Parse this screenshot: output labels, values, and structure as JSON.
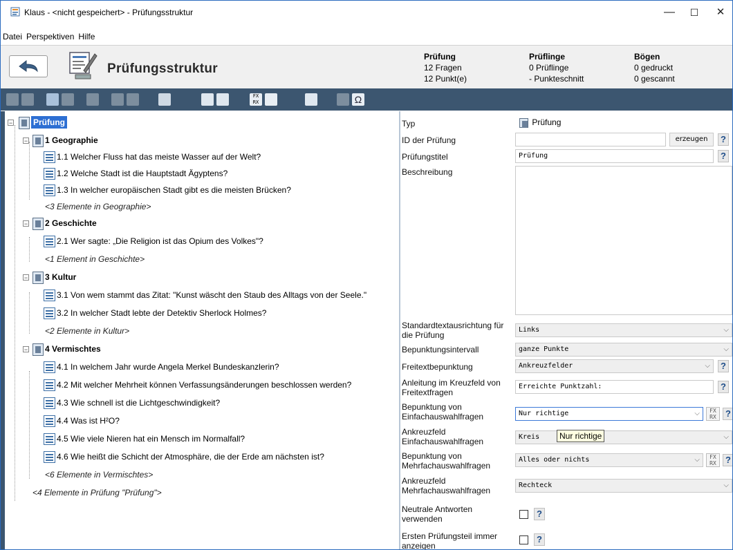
{
  "window": {
    "title": "Klaus - <nicht gespeichert> - Prüfungsstruktur",
    "minimize": "—",
    "maximize": "☐",
    "close": "✕"
  },
  "menu": [
    "Datei",
    "Perspektiven",
    "Hilfe"
  ],
  "header": {
    "title": "Prüfungsstruktur",
    "stats": [
      {
        "heading": "Prüfung",
        "line1": "12 Fragen",
        "line2": "12 Punkt(e)"
      },
      {
        "heading": "Prüflinge",
        "line1": "0 Prüflinge",
        "line2": "- Punkteschnitt"
      },
      {
        "heading": "Bögen",
        "line1": "0 gedruckt",
        "line2": "0 gescannt"
      }
    ]
  },
  "tree": {
    "root": "Prüfung",
    "sections": [
      {
        "label": "1 Geographie",
        "questions": [
          "1.1 Welcher Fluss hat das meiste Wasser auf der Welt?",
          "1.2 Welche Stadt ist die Hauptstadt Ägyptens?",
          "1.3 In welcher europäischen Stadt gibt es die meisten Brücken?"
        ],
        "summary": "<3 Elemente in Geographie>"
      },
      {
        "label": "2 Geschichte",
        "questions": [
          "2.1 Wer sagte: „Die Religion ist das Opium des Volkes\"?"
        ],
        "summary": "<1 Element in Geschichte>"
      },
      {
        "label": "3 Kultur",
        "questions": [
          "3.1 Von wem stammt das Zitat: \"Kunst wäscht den Staub des Alltags von der Seele.\"",
          "3.2 In welcher Stadt lebte der Detektiv Sherlock Holmes?"
        ],
        "summary": "<2 Elemente in Kultur>"
      },
      {
        "label": "4 Vermischtes",
        "questions": [
          "4.1 In welchem Jahr wurde Angela Merkel Bundeskanzlerin?",
          "4.2 Mit welcher Mehrheit können Verfassungsänderungen beschlossen werden?",
          "4.3 Wie schnell ist die Lichtgeschwindigkeit?",
          "4.4 Was ist H²O?",
          "4.5 Wie viele Nieren hat ein Mensch im Normalfall?",
          "4.6 Wie heißt die Schicht der Atmosphäre, die der Erde am nächsten ist?"
        ],
        "summary": "<6 Elemente in Vermischtes>"
      }
    ],
    "root_summary": "<4 Elemente in Prüfung \"Prüfung\">"
  },
  "form": {
    "typ_label": "Typ",
    "typ_value": "Prüfung",
    "id_label": "ID der Prüfung",
    "id_value": "",
    "id_button": "erzeugen",
    "title_label": "Prüfungstitel",
    "title_value": "Prüfung",
    "desc_label": "Beschreibung",
    "desc_value": "",
    "align_label": "Standardtextausrichtung für die Prüfung",
    "align_value": "Links",
    "interval_label": "Bepunktungsintervall",
    "interval_value": "ganze Punkte",
    "freetext_label": "Freitextbepunktung",
    "freetext_value": "Ankreuzfelder",
    "guide_label": "Anleitung im Kreuzfeld von Freitextfragen",
    "guide_value": "Erreichte Punktzahl:",
    "single_label": "Bepunktung von Einfachauswahlfragen",
    "single_value": "Nur richtige",
    "single_box_label": "Ankreuzfeld Einfachauswahlfragen",
    "single_box_value": "Kreis",
    "tooltip": "Nur richtige",
    "multi_label": "Bepunktung von Mehrfachauswahlfragen",
    "multi_value": "Alles oder nichts",
    "multi_box_label": "Ankreuzfeld Mehrfachauswahlfragen",
    "multi_box_value": "Rechteck",
    "neutral_label": "Neutrale Antworten verwenden",
    "first_label": "Ersten Prüfungsteil immer anzeigen",
    "help": "?",
    "fx": "FX RX",
    "omega": "Ω"
  },
  "colors": {
    "toolbar": "#3c5670",
    "selection": "#2d6fd3",
    "header_bg": "#f0f0f0"
  }
}
